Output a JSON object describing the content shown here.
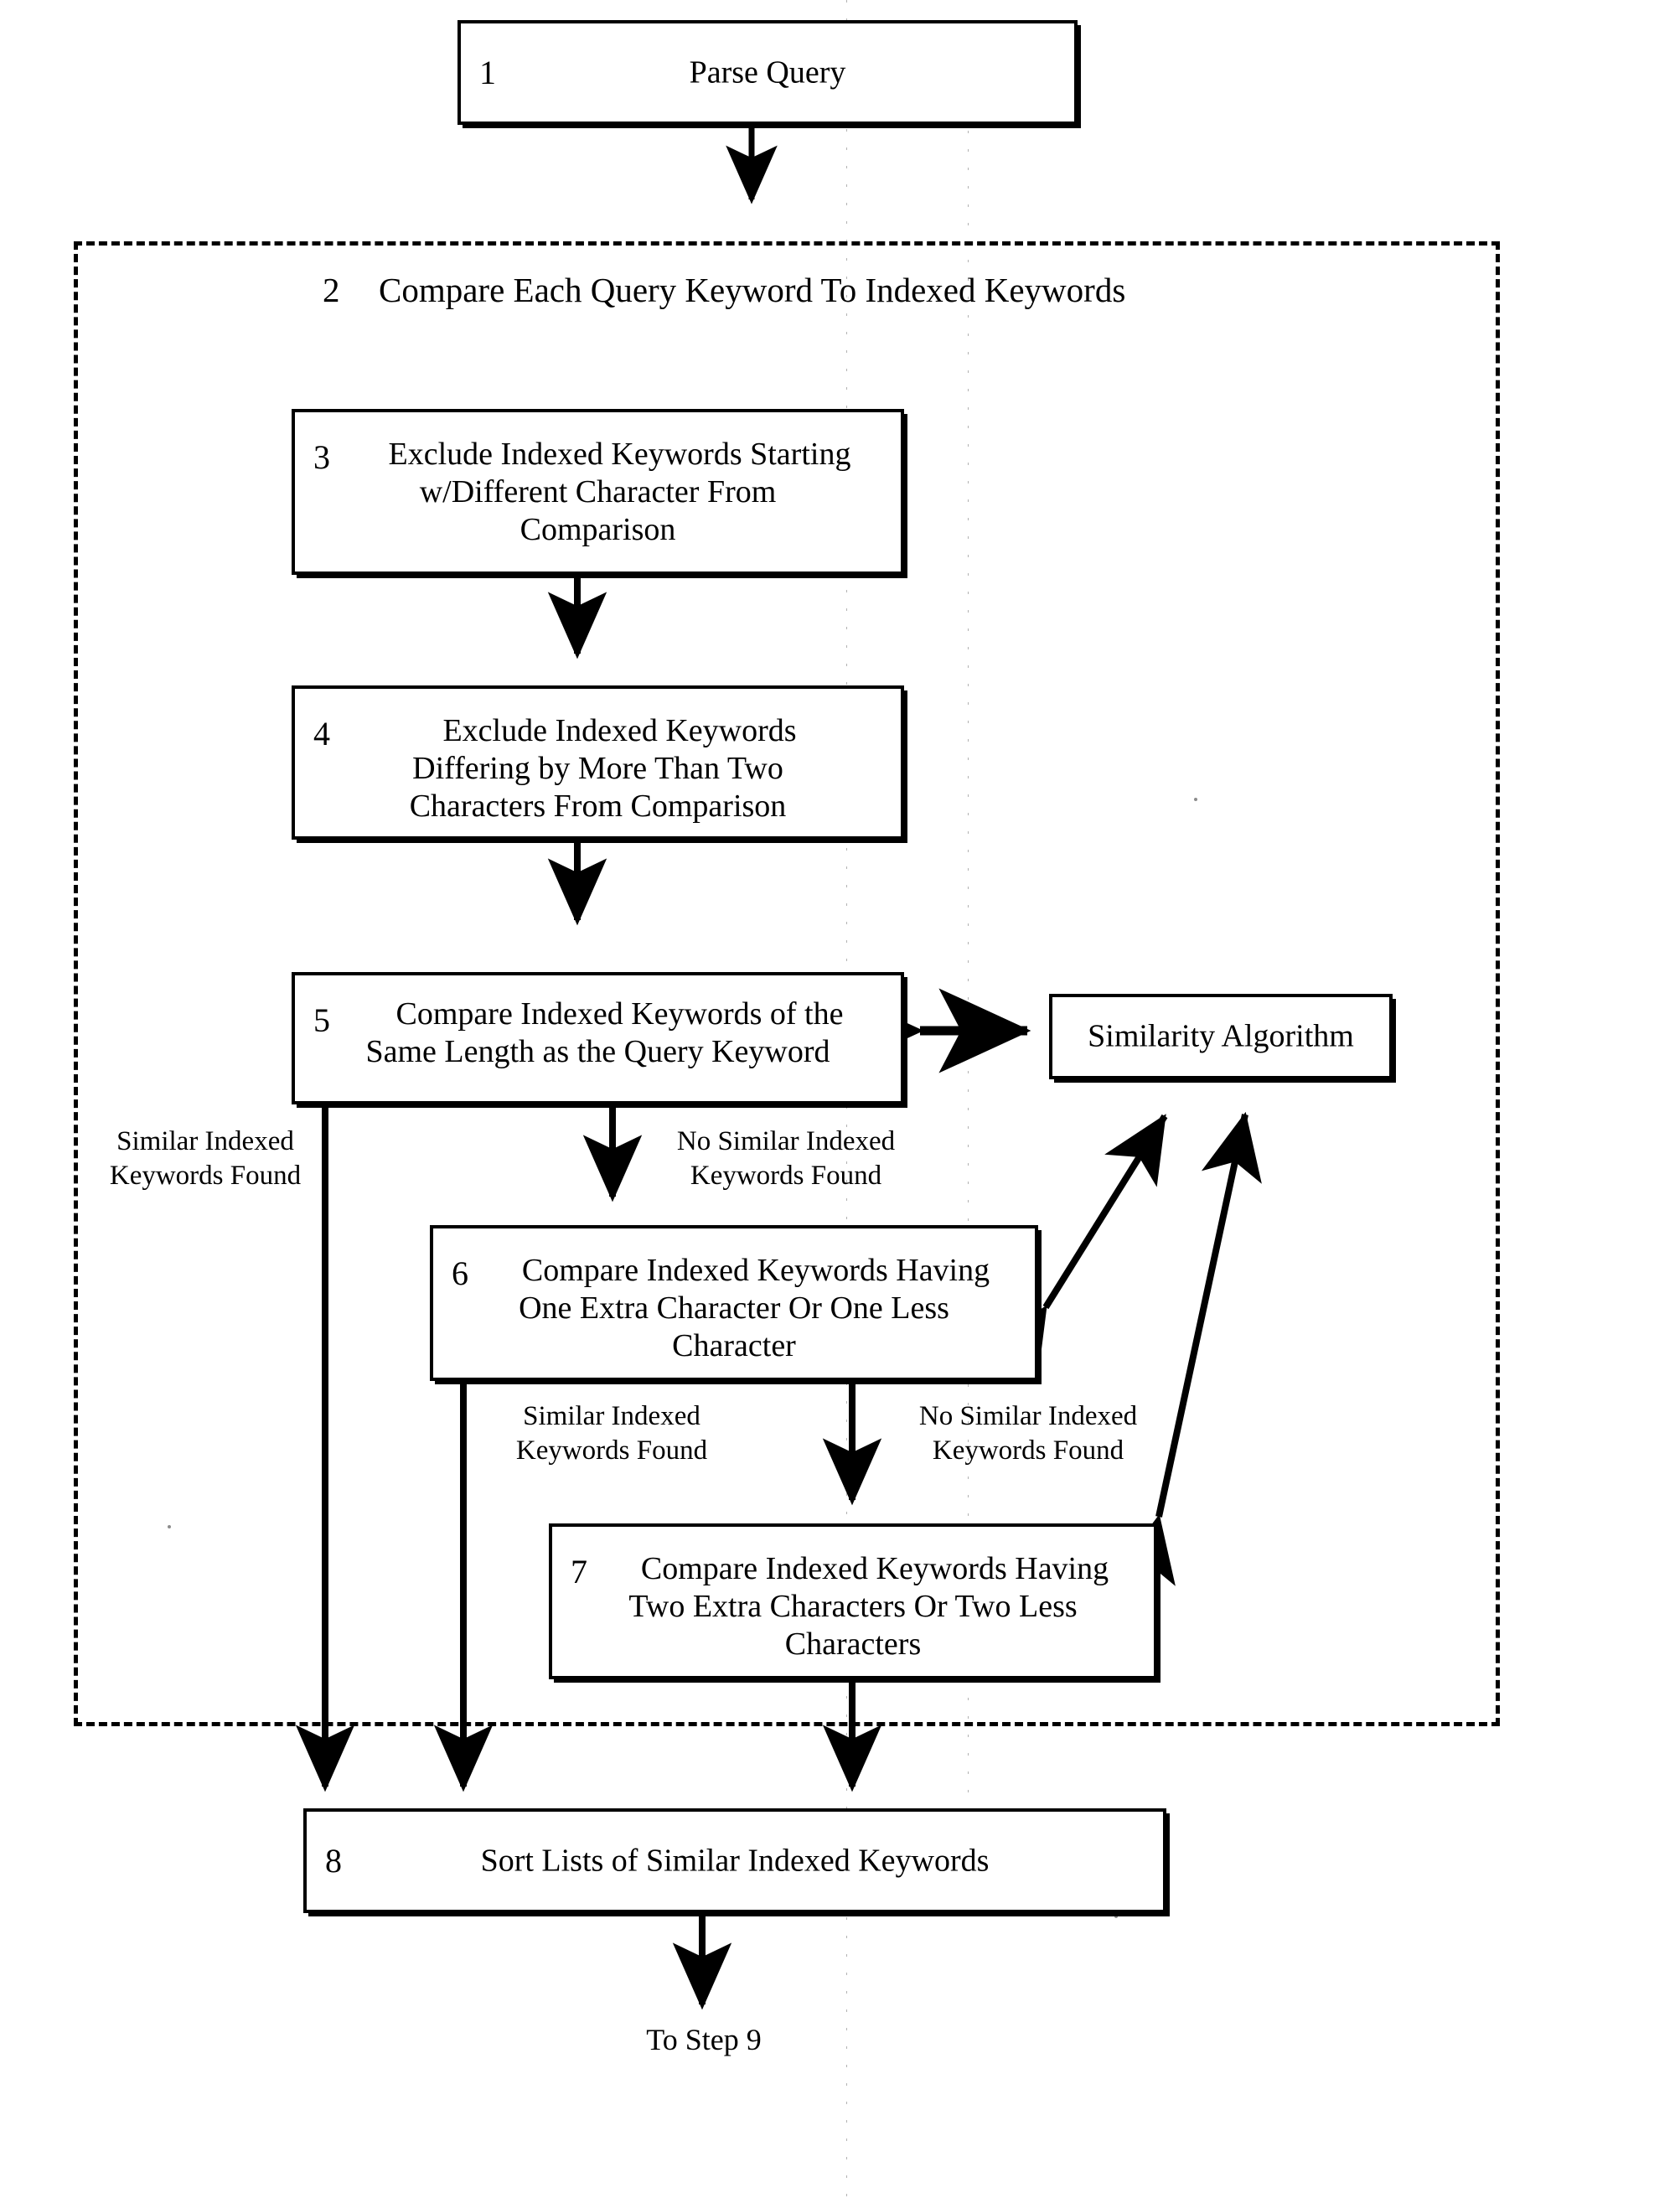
{
  "diagram": {
    "title_number_1": "1",
    "boxes": [
      {
        "id": "box1",
        "number": "1",
        "label": "Parse Query"
      },
      {
        "id": "box3",
        "number": "3",
        "label": "Exclude Indexed Keywords Starting w/Different Character From Comparison"
      },
      {
        "id": "box4",
        "number": "4",
        "label": "Exclude Indexed Keywords Differing by More Than Two Characters From Comparison"
      },
      {
        "id": "box5",
        "number": "5",
        "label": "Compare Indexed Keywords of the Same Length as the Query Keyword"
      },
      {
        "id": "box6",
        "number": "6",
        "label": "Compare Indexed Keywords Having One Extra Character Or One Less Character"
      },
      {
        "id": "box7",
        "number": "7",
        "label": "Compare Indexed Keywords Having Two Extra Characters Or Two Less Characters"
      },
      {
        "id": "box8",
        "number": "8",
        "label": "Sort Lists of Similar Indexed Keywords"
      },
      {
        "id": "similarity",
        "number": "",
        "label": "Similarity Algorithm"
      }
    ],
    "box1": {
      "number": "1",
      "label": "Parse Query"
    },
    "box3": {
      "number": "3",
      "line1": "Exclude Indexed Keywords Starting",
      "line2": "w/Different Character From",
      "line3": "Comparison"
    },
    "box4": {
      "number": "4",
      "line1": "Exclude Indexed Keywords",
      "line2": "Differing by More Than Two",
      "line3": "Characters From Comparison"
    },
    "box5": {
      "number": "5",
      "line1": "Compare Indexed Keywords of the",
      "line2": "Same Length as the Query Keyword"
    },
    "box6": {
      "number": "6",
      "line1": "Compare Indexed Keywords Having",
      "line2": "One Extra Character Or One Less",
      "line3": "Character"
    },
    "box7": {
      "number": "7",
      "line1": "Compare Indexed Keywords Having",
      "line2": "Two Extra Characters Or Two Less",
      "line3": "Characters"
    },
    "box8": {
      "number": "8",
      "label": "Sort Lists of Similar Indexed Keywords"
    },
    "similarity_box": {
      "label": "Similarity Algorithm"
    },
    "region2": {
      "number": "2",
      "label": "Compare Each Query Keyword To Indexed Keywords"
    },
    "labels": {
      "similar_found_5_line1": "Similar Indexed",
      "similar_found_5_line2": "Keywords Found",
      "no_similar_5_line1": "No Similar Indexed",
      "no_similar_5_line2": "Keywords Found",
      "similar_found_6_line1": "Similar Indexed",
      "similar_found_6_line2": "Keywords Found",
      "no_similar_6_line1": "No Similar Indexed",
      "no_similar_6_line2": "Keywords Found",
      "to_step_9": "To Step 9"
    },
    "colors": {
      "ink": "#000000",
      "paper": "#ffffff"
    }
  }
}
